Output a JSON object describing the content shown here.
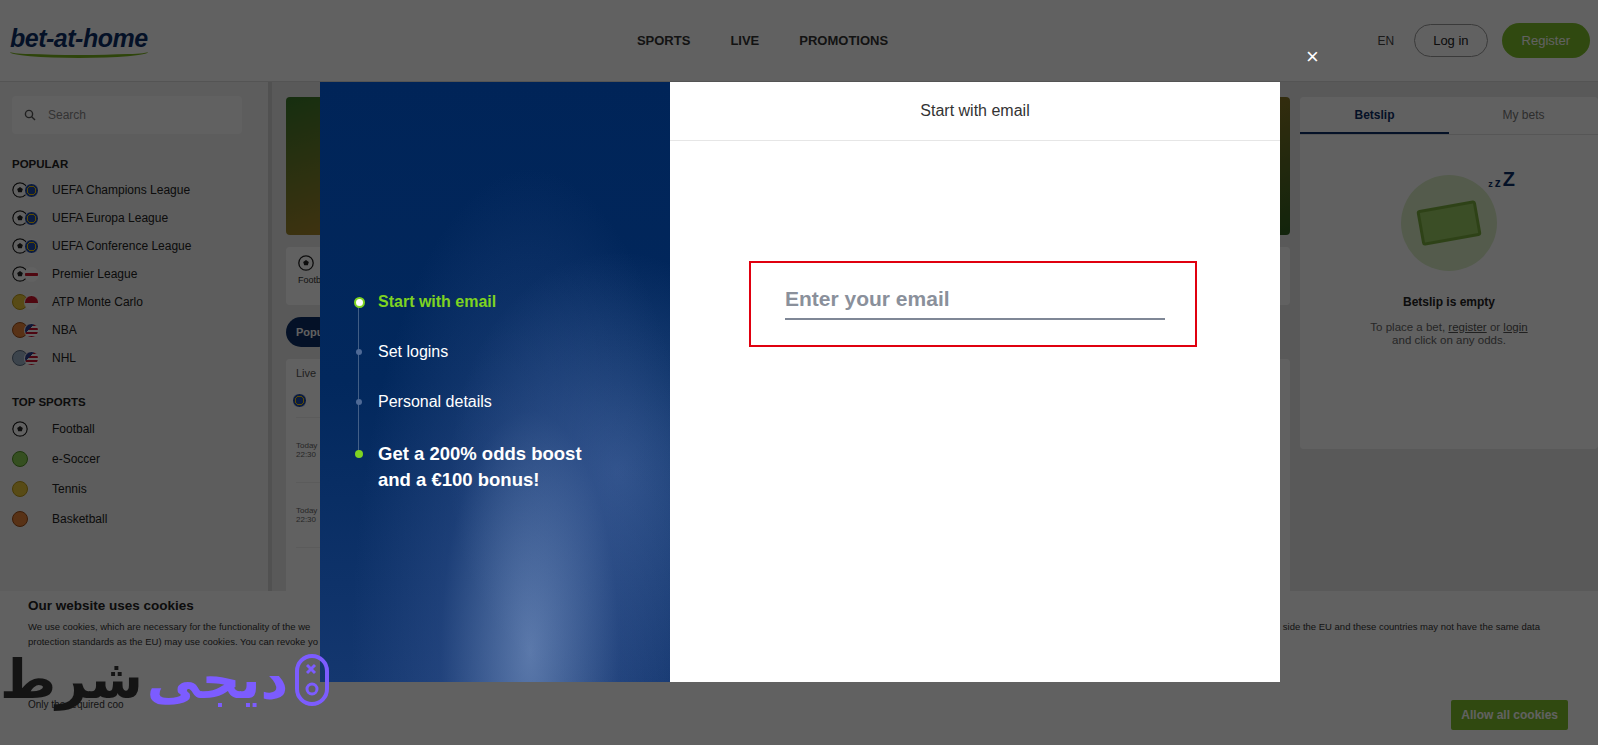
{
  "header": {
    "logo": "bet-at-home",
    "nav": [
      "SPORTS",
      "LIVE",
      "PROMOTIONS"
    ],
    "language": "EN",
    "login": "Log in",
    "register": "Register"
  },
  "sidebar": {
    "search_placeholder": "Search",
    "sections": [
      {
        "title": "POPULAR",
        "items": [
          {
            "label": "UEFA Champions League",
            "kind": "football-eu"
          },
          {
            "label": "UEFA Europa League",
            "kind": "football-eu"
          },
          {
            "label": "UEFA Conference League",
            "kind": "football-eu"
          },
          {
            "label": "Premier League",
            "kind": "football-england"
          },
          {
            "label": "ATP Monte Carlo",
            "kind": "tennis-monaco"
          },
          {
            "label": "NBA",
            "kind": "basketball-usa"
          },
          {
            "label": "NHL",
            "kind": "hockey-usa"
          }
        ]
      },
      {
        "title": "TOP SPORTS",
        "items": [
          {
            "label": "Football",
            "kind": "football-none"
          },
          {
            "label": "e-Soccer",
            "kind": "esoccer-none"
          },
          {
            "label": "Tennis",
            "kind": "tennis-none"
          },
          {
            "label": "Basketball",
            "kind": "basketball-none"
          }
        ]
      }
    ]
  },
  "center": {
    "tab": "Footb",
    "pill": "Popu",
    "section": "Live",
    "rows": [
      {
        "day": "Today",
        "time": "22:30"
      },
      {
        "day": "Today",
        "time": "22:30"
      }
    ]
  },
  "betslip": {
    "tabs": [
      {
        "label": "Betslip",
        "selected": true
      },
      {
        "label": "My bets",
        "selected": false
      }
    ],
    "sleep_marks": [
      "z",
      "z",
      "Z"
    ],
    "empty_title": "Betslip is empty",
    "message": {
      "before": "To place a bet, ",
      "register": "register",
      "middle": " or ",
      "login": "login",
      "after": " and click on any odds."
    }
  },
  "modal": {
    "close": "×",
    "title": "Start with email",
    "steps": [
      {
        "label": "Start with email",
        "selected": true,
        "kind": "step"
      },
      {
        "label": "Set logins",
        "selected": false,
        "kind": "step"
      },
      {
        "label": "Personal details",
        "selected": false,
        "kind": "step"
      },
      {
        "label": "Get a 200% odds boost and a €100 bonus!",
        "selected": false,
        "kind": "bonus"
      }
    ],
    "email": {
      "placeholder": "Enter your email",
      "highlighted": true
    }
  },
  "cookies": {
    "title": "Our website uses cookies",
    "lines_left": [
      "We use cookies, which are necessary for the functionality of the we",
      "protection standards as the EU) may use cookies. You can revoke yo"
    ],
    "line_right": "side the EU and these countries may not have the same data",
    "footer": "Only the required coo",
    "allow_all": "Allow all cookies"
  },
  "watermark": {
    "dark": "شرط",
    "light": "دیجی"
  }
}
